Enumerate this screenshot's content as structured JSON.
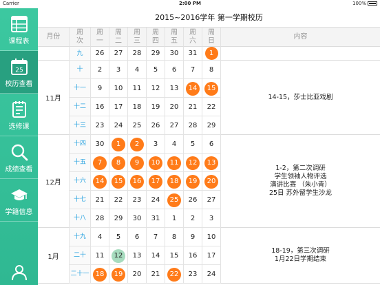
{
  "status": {
    "carrier": "Carrier",
    "time": "2:00 PM",
    "battery": "100%"
  },
  "sidebar": {
    "items": [
      {
        "label": "课程表",
        "icon": "schedule-icon"
      },
      {
        "label": "校历查看",
        "icon": "calendar-icon"
      },
      {
        "label": "选修课",
        "icon": "elective-icon"
      },
      {
        "label": "成绩查看",
        "icon": "search-icon"
      },
      {
        "label": "学籍信息",
        "icon": "graduation-cap-icon"
      },
      {
        "label": "",
        "icon": "user-icon"
      }
    ],
    "calendar_day": "25"
  },
  "title": "2015~2016学年 第一学期校历",
  "headers": {
    "month": "月份",
    "week": [
      "周",
      "次"
    ],
    "days": [
      [
        "周",
        "一"
      ],
      [
        "周",
        "二"
      ],
      [
        "周",
        "三"
      ],
      [
        "周",
        "四"
      ],
      [
        "周",
        "五"
      ],
      [
        "周",
        "六"
      ],
      [
        "周",
        "日"
      ]
    ],
    "content": "内容"
  },
  "rows": [
    {
      "week": "九",
      "days": [
        {
          "d": "26"
        },
        {
          "d": "27"
        },
        {
          "d": "28"
        },
        {
          "d": "29"
        },
        {
          "d": "30"
        },
        {
          "d": "31"
        },
        {
          "d": "1",
          "h": "orange"
        }
      ]
    },
    {
      "week": "十",
      "days": [
        {
          "d": "2"
        },
        {
          "d": "3"
        },
        {
          "d": "4"
        },
        {
          "d": "5"
        },
        {
          "d": "6"
        },
        {
          "d": "7"
        },
        {
          "d": "8"
        }
      ]
    },
    {
      "week": "十一",
      "days": [
        {
          "d": "9"
        },
        {
          "d": "10"
        },
        {
          "d": "11"
        },
        {
          "d": "12"
        },
        {
          "d": "13"
        },
        {
          "d": "14",
          "h": "orange"
        },
        {
          "d": "15",
          "h": "orange"
        }
      ]
    },
    {
      "week": "十二",
      "days": [
        {
          "d": "16"
        },
        {
          "d": "17"
        },
        {
          "d": "18"
        },
        {
          "d": "19"
        },
        {
          "d": "20"
        },
        {
          "d": "21"
        },
        {
          "d": "22"
        }
      ]
    },
    {
      "week": "十三",
      "days": [
        {
          "d": "23"
        },
        {
          "d": "24"
        },
        {
          "d": "25"
        },
        {
          "d": "26"
        },
        {
          "d": "27"
        },
        {
          "d": "28"
        },
        {
          "d": "29"
        }
      ]
    },
    {
      "week": "十四",
      "days": [
        {
          "d": "30"
        },
        {
          "d": "1",
          "h": "orange"
        },
        {
          "d": "2",
          "h": "orange"
        },
        {
          "d": "3"
        },
        {
          "d": "4"
        },
        {
          "d": "5"
        },
        {
          "d": "6"
        }
      ]
    },
    {
      "week": "十五",
      "days": [
        {
          "d": "7",
          "h": "orange"
        },
        {
          "d": "8",
          "h": "orange"
        },
        {
          "d": "9",
          "h": "orange"
        },
        {
          "d": "10",
          "h": "orange"
        },
        {
          "d": "11",
          "h": "orange"
        },
        {
          "d": "12",
          "h": "orange"
        },
        {
          "d": "13",
          "h": "orange"
        }
      ]
    },
    {
      "week": "十六",
      "days": [
        {
          "d": "14",
          "h": "orange"
        },
        {
          "d": "15",
          "h": "orange"
        },
        {
          "d": "16",
          "h": "orange"
        },
        {
          "d": "17",
          "h": "orange"
        },
        {
          "d": "18",
          "h": "orange"
        },
        {
          "d": "19",
          "h": "orange"
        },
        {
          "d": "20",
          "h": "orange"
        }
      ]
    },
    {
      "week": "十七",
      "days": [
        {
          "d": "21"
        },
        {
          "d": "22"
        },
        {
          "d": "23"
        },
        {
          "d": "24"
        },
        {
          "d": "25",
          "h": "orange"
        },
        {
          "d": "26"
        },
        {
          "d": "27"
        }
      ]
    },
    {
      "week": "十八",
      "days": [
        {
          "d": "28"
        },
        {
          "d": "29"
        },
        {
          "d": "30"
        },
        {
          "d": "31"
        },
        {
          "d": "1"
        },
        {
          "d": "2"
        },
        {
          "d": "3"
        }
      ]
    },
    {
      "week": "十九",
      "days": [
        {
          "d": "4"
        },
        {
          "d": "5"
        },
        {
          "d": "6"
        },
        {
          "d": "7"
        },
        {
          "d": "8"
        },
        {
          "d": "9"
        },
        {
          "d": "10"
        }
      ]
    },
    {
      "week": "二十",
      "days": [
        {
          "d": "11"
        },
        {
          "d": "12",
          "h": "green"
        },
        {
          "d": "13"
        },
        {
          "d": "14"
        },
        {
          "d": "15"
        },
        {
          "d": "16"
        },
        {
          "d": "17"
        }
      ]
    },
    {
      "week": "二十一",
      "days": [
        {
          "d": "18",
          "h": "orange"
        },
        {
          "d": "19",
          "h": "orange"
        },
        {
          "d": "20"
        },
        {
          "d": "21"
        },
        {
          "d": "22",
          "h": "orange"
        },
        {
          "d": "23"
        },
        {
          "d": "24"
        }
      ]
    }
  ],
  "months": [
    {
      "label": "",
      "rows": [
        0,
        0
      ]
    },
    {
      "label": "11月",
      "rows": [
        1,
        4
      ]
    },
    {
      "label": "12月",
      "rows": [
        5,
        9
      ]
    },
    {
      "label": "1月",
      "rows": [
        10,
        12
      ]
    }
  ],
  "contents": [
    {
      "rows": [
        0,
        0
      ],
      "lines": []
    },
    {
      "rows": [
        1,
        4
      ],
      "lines": [
        "14-15，莎士比亚戏剧"
      ]
    },
    {
      "rows": [
        5,
        9
      ],
      "lines": [
        "1-2，第二次调研",
        "学生领袖人物评选",
        "演讲比赛 （朱小青）",
        "25日 苏外留学生沙龙"
      ]
    },
    {
      "rows": [
        10,
        12
      ],
      "lines": [
        "18-19，第三次调研",
        "1月22日学期结束"
      ]
    }
  ],
  "colors": {
    "accent": "#3cc8a0",
    "highlight": "#ff7b19",
    "today": "#a7dcbf",
    "week_text": "#2aa3e0"
  }
}
